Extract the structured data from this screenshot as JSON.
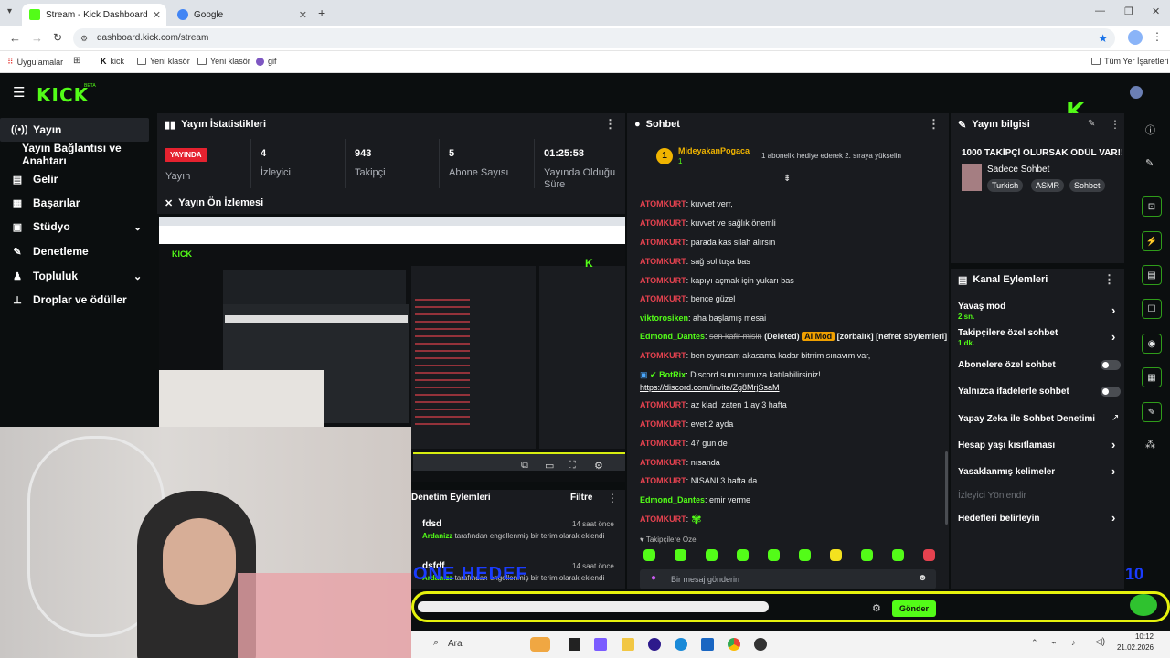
{
  "browser": {
    "tabs": [
      {
        "label": "Stream - Kick Dashboard",
        "active": true
      },
      {
        "label": "Google",
        "active": false
      }
    ],
    "url": "dashboard.kick.com/stream",
    "bookmarks": [
      "Uygulamalar",
      "kick",
      "Yeni klasör",
      "Yeni klasör",
      "gif"
    ],
    "bookmarks_right": "Tüm Yer İşaretleri"
  },
  "kick": {
    "logo": "KICK",
    "beta": "BETA"
  },
  "sidebar": {
    "items": [
      {
        "label": "Yayın",
        "icon": "broadcast-icon"
      },
      {
        "label": "Yayın Bağlantısı ve Anahtarı",
        "icon": ""
      },
      {
        "label": "Gelir",
        "icon": "revenue-icon"
      },
      {
        "label": "Başarılar",
        "icon": "achievements-icon"
      },
      {
        "label": "Stüdyo",
        "icon": "studio-icon"
      },
      {
        "label": "Denetleme",
        "icon": "moderation-icon"
      },
      {
        "label": "Topluluk",
        "icon": "community-icon"
      },
      {
        "label": "Droplar ve ödüller",
        "icon": "drops-icon"
      }
    ]
  },
  "stats": {
    "title": "Yayın İstatistikleri",
    "live_badge": "YAYINDA",
    "live_label": "Yayın",
    "viewers": "4",
    "viewers_label": "İzleyici",
    "followers": "943",
    "followers_label": "Takipçi",
    "subs": "5",
    "subs_label": "Abone Sayısı",
    "duration": "01:25:58",
    "duration_label": "Yayında Olduğu Süre"
  },
  "preview": {
    "title": "Yayın Ön İzlemesi"
  },
  "moderation": {
    "title": "Denetim Eylemleri",
    "filter": "Filtre",
    "entries": [
      {
        "user": "fdsd",
        "actor": "Ardanizz",
        "text": "tarafından engellenmiş bir terim olarak eklendi",
        "time": "14 saat önce"
      },
      {
        "user": "dsfdf",
        "actor": "Ardanizz",
        "text": "tarafından engellenmiş bir terim olarak eklendi",
        "time": "14 saat önce"
      }
    ]
  },
  "chat": {
    "title": "Sohbet",
    "pinned_user": "MideyakanPogaca",
    "pinned_count": "1",
    "pinned_text": "1 abonelik hediye ederek 2. sıraya yükselin",
    "messages": [
      {
        "user": "ATOMKURT",
        "color": "#e5424f",
        "text": "kuvvet verr,"
      },
      {
        "user": "ATOMKURT",
        "color": "#e5424f",
        "text": "kuvvet ve sağlık önemli"
      },
      {
        "user": "ATOMKURT",
        "color": "#e5424f",
        "text": "parada kas silah alırsın"
      },
      {
        "user": "ATOMKURT",
        "color": "#e5424f",
        "text": "sağ sol tuşa bas"
      },
      {
        "user": "ATOMKURT",
        "color": "#e5424f",
        "text": "kapıyı açmak için yukarı bas"
      },
      {
        "user": "ATOMKURT",
        "color": "#e5424f",
        "text": "bence güzel"
      },
      {
        "user": "viktorosiken",
        "color": "#53fc18",
        "text": "aha başlamış mesai"
      },
      {
        "user": "ATOMKURT",
        "color": "#e5424f",
        "text": "ben oyunsam akasama kadar bitrrim sınavım var,"
      },
      {
        "user": "ATOMKURT",
        "color": "#e5424f",
        "text": "az kladı zaten 1 ay 3 hafta"
      },
      {
        "user": "ATOMKURT",
        "color": "#e5424f",
        "text": "evet 2 ayda"
      },
      {
        "user": "ATOMKURT",
        "color": "#e5424f",
        "text": "47 gun de"
      },
      {
        "user": "ATOMKURT",
        "color": "#e5424f",
        "text": "nısanda"
      },
      {
        "user": "ATOMKURT",
        "color": "#e5424f",
        "text": "NISANI 3 hafta da"
      },
      {
        "user": "Edmond_Dantes",
        "color": "#53fc18",
        "text": "emir verme"
      },
      {
        "user": "ATOMKURT",
        "color": "#e5424f",
        "text": ""
      }
    ],
    "deleted": {
      "user": "Edmond_Dantes",
      "struck": "sen kafir misin",
      "deleted_tag": "(Deleted)",
      "badge": "AI Mod",
      "tags": "[zorbalık] [nefret söylemleri]"
    },
    "bot": {
      "user": "BotRix",
      "text": "Discord sunucumuza katılabilirsiniz!",
      "link": "https://discord.com/invite/Zg8MrjSsaM"
    },
    "followers_only": "Takipçilere Özel",
    "input_placeholder": "Bir mesaj gönderin",
    "send": "Gönder",
    "overlay_goal": "5 / 10",
    "overlay_text": "ONE HEDEF"
  },
  "stream_info": {
    "title": "Yayın bilgisi",
    "stream_title": "1000 TAKİPÇİ OLURSAK ÖDÜL VAR!!!",
    "category": "Sadece Sohbet",
    "tags": [
      "Turkish",
      "ASMR",
      "Sohbet"
    ]
  },
  "channel_actions": {
    "title": "Kanal Eylemleri",
    "items": [
      {
        "label": "Yavaş mod",
        "sub": "2 sn.",
        "control": "chevron"
      },
      {
        "label": "Takipçilere özel sohbet",
        "sub": "1 dk.",
        "control": "chevron"
      },
      {
        "label": "Abonelere özel sohbet",
        "sub": "",
        "control": "toggle"
      },
      {
        "label": "Yalnızca ifadelerle sohbet",
        "sub": "",
        "control": "toggle"
      },
      {
        "label": "Yapay Zeka ile Sohbet Denetimi",
        "sub": "",
        "control": "external"
      },
      {
        "label": "Hesap yaşı kısıtlaması",
        "sub": "",
        "control": "chevron"
      },
      {
        "label": "Yasaklanmış kelimeler",
        "sub": "",
        "control": "chevron"
      },
      {
        "label": "İzleyici Yönlendir",
        "sub": "",
        "control": "none"
      },
      {
        "label": "Hedefleri belirleyin",
        "sub": "",
        "control": "chevron"
      }
    ]
  },
  "taskbar": {
    "search": "Ara",
    "time": "10:12",
    "date": "21.02.2026"
  },
  "colors": {
    "kick_green": "#53fc18",
    "live_red": "#e5222f",
    "panel": "#191b1f"
  }
}
